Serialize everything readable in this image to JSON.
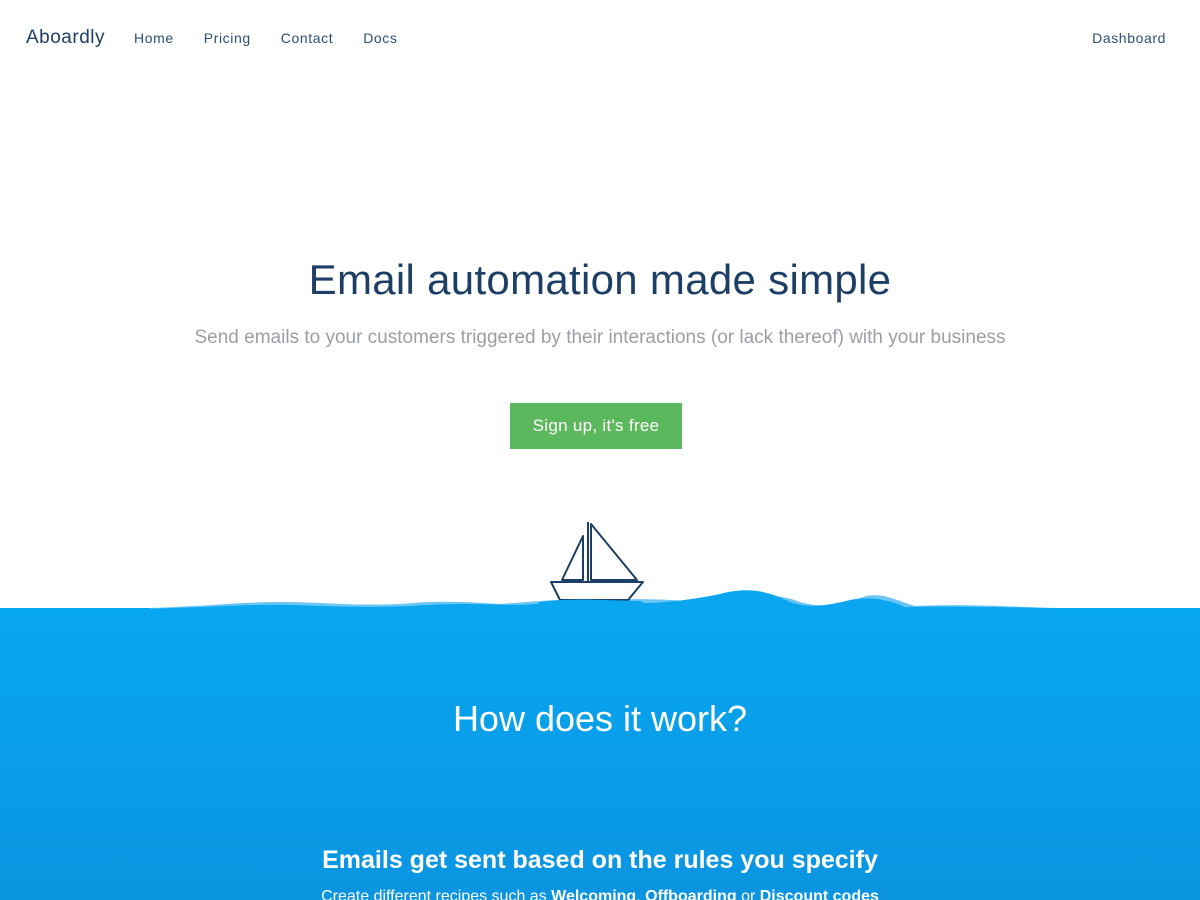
{
  "nav": {
    "brand": "Aboardly",
    "links": [
      "Home",
      "Pricing",
      "Contact",
      "Docs"
    ],
    "right_link": "Dashboard"
  },
  "hero": {
    "title": "Email automation made simple",
    "subtitle": "Send emails to your customers triggered by their interactions (or lack thereof) with your business",
    "cta_label": "Sign up, it's free"
  },
  "how": {
    "title": "How does it work?",
    "feature_title": "Emails get sent based on the rules you specify",
    "feature_text_prefix": "Create different recipes such as ",
    "feature_highlight_1": "Welcoming",
    "feature_sep": ", ",
    "feature_highlight_2": "Offboarding",
    "feature_or": " or ",
    "feature_highlight_3": "Discount codes"
  },
  "colors": {
    "accent_green": "#5cb85c",
    "ocean_blue": "#08a7f1",
    "navy": "#1d3f66"
  },
  "icons": {
    "illustration": "sailboat-on-waves"
  }
}
